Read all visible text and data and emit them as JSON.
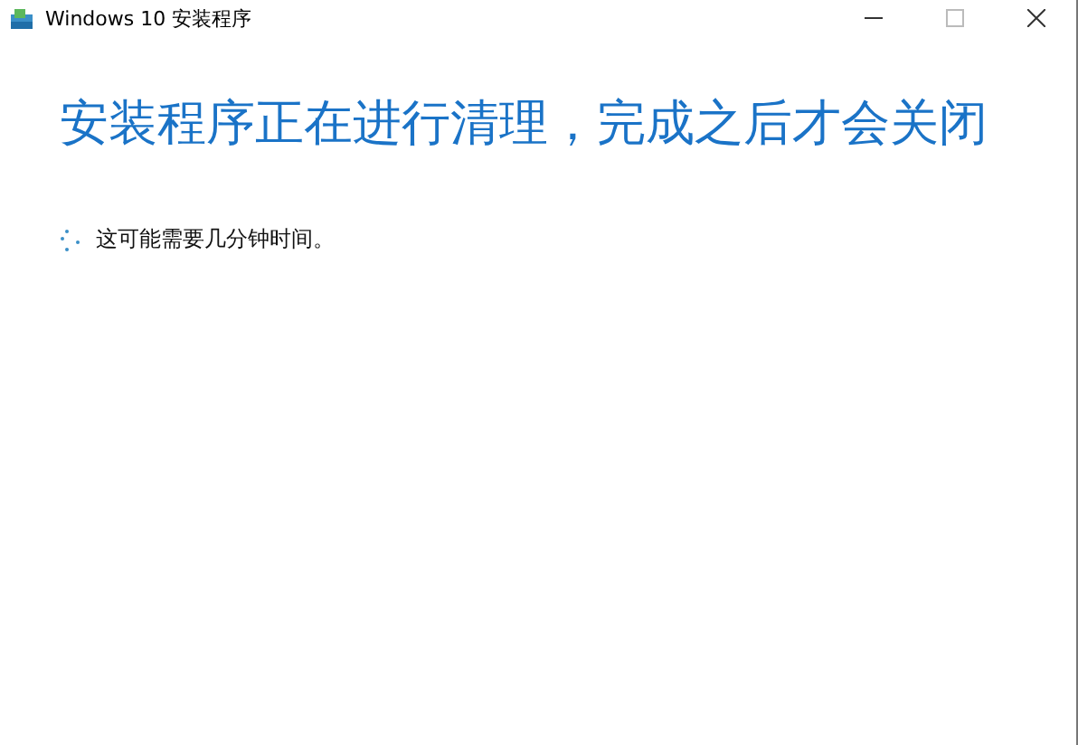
{
  "window": {
    "title": "Windows 10 安装程序"
  },
  "heading": "安装程序正在进行清理，完成之后才会关闭",
  "status": "这可能需要几分钟时间。"
}
